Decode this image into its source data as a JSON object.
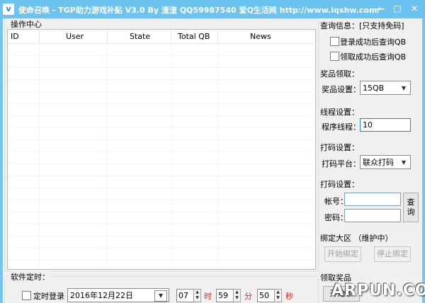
{
  "titlebar": {
    "title": "使命召唤 - TGP助力游戏补贴 V3.0  By 渣渣 QQ59987540    爱Q生活网 http://www.iqshw.com/",
    "minimize_glyph": "—",
    "maximize_glyph": "□",
    "close_glyph": "✕"
  },
  "operations": {
    "legend": "操作中心",
    "columns": [
      "ID",
      "User",
      "State",
      "Total QB",
      "News"
    ]
  },
  "query_info": {
    "title": "查询信息：[只支持免码]",
    "login_check": "登录成功后查询QB",
    "claim_check": "领取成功后查询QB"
  },
  "prize": {
    "title": "奖品领取：",
    "label": "奖品设置：",
    "value": "15QB"
  },
  "thread": {
    "title": "线程设置：",
    "label": "程序线程：",
    "value": "10"
  },
  "captcha": {
    "title": "打码设置：",
    "label": "打码平台：",
    "value": "联众打码"
  },
  "captcha_account": {
    "title": "打码设置：",
    "account_label": "帐号：",
    "password_label": "密码：",
    "query_button": "查询"
  },
  "bind": {
    "title": "绑定大区   （维护中）",
    "start_button": "开始绑定",
    "stop_button": "停止绑定"
  },
  "claim": {
    "title": "领取奖品",
    "start_button": "开始领"
  },
  "schedule": {
    "legend": "软件定时：",
    "timer_login": "定时登录",
    "date": "2016年12月22日",
    "hour": "07",
    "hour_unit": "时",
    "minute": "59",
    "minute_unit": "分",
    "second": "50",
    "second_unit": "秒"
  },
  "watermark": "ARPUN.COM",
  "colors": {
    "titlebar": "#6cc3f0",
    "accent_red": "#e02020"
  }
}
